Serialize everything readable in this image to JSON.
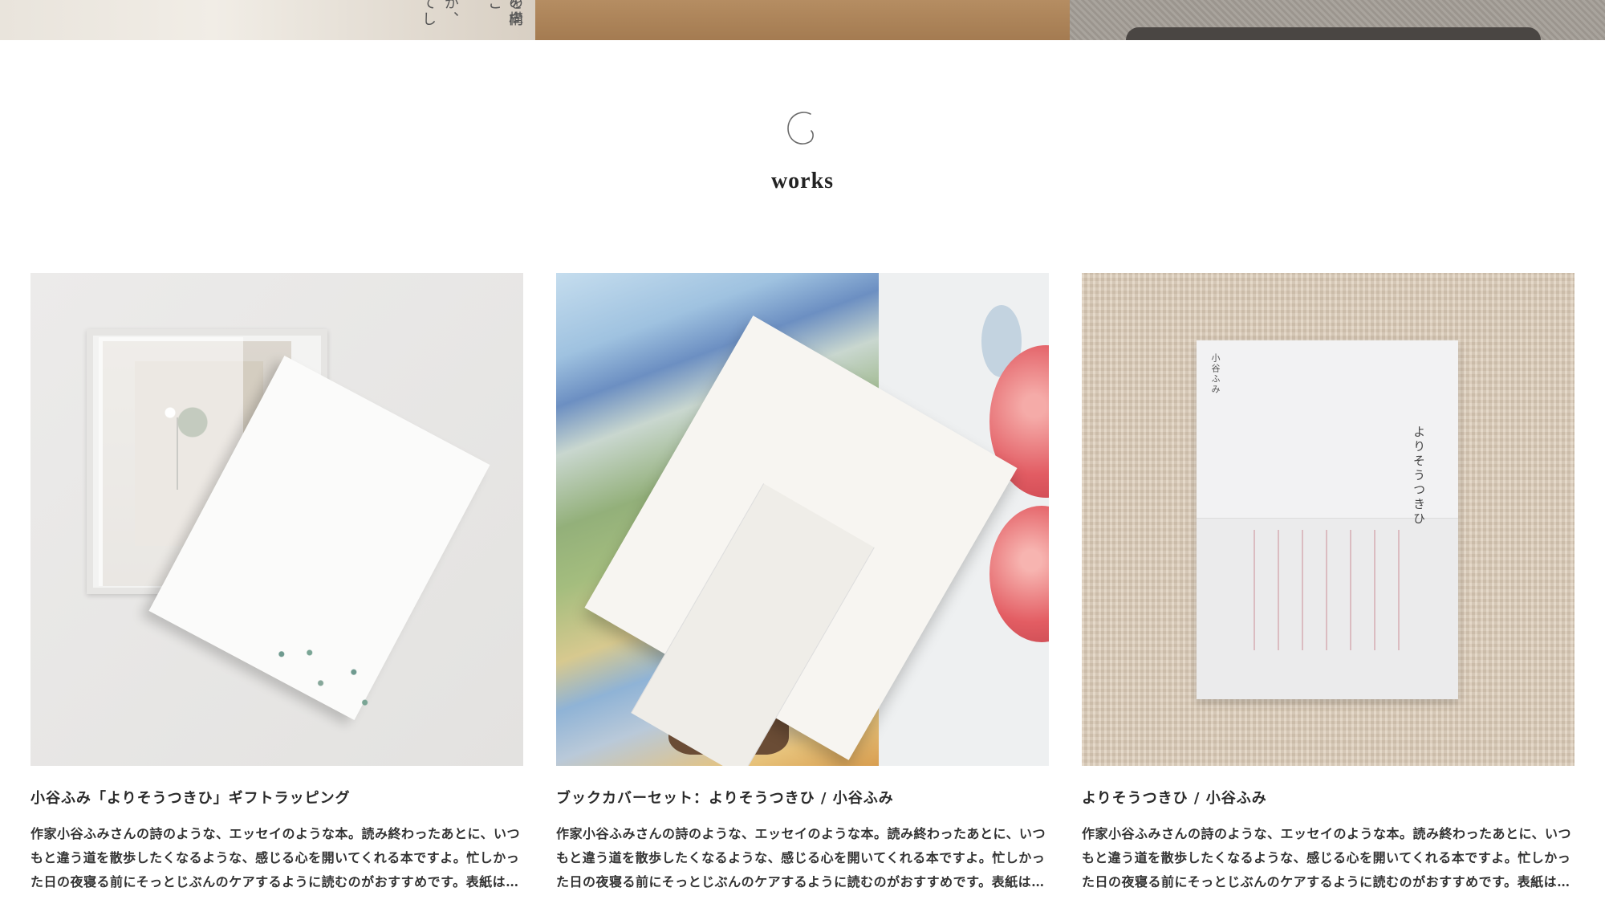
{
  "top_strip": {
    "vertical_text_1": "を構",
    "vertical_text_2": "の向こ",
    "vertical_text_3": "が、",
    "vertical_text_4": "てし"
  },
  "section": {
    "title": "works"
  },
  "works": [
    {
      "title": "小谷ふみ「よりそうつきひ」ギフトラッピング",
      "description": "作家小谷ふみさんの詩のような、エッセイのような本。読み終わったあとに、いつもと違う道を散歩したくなるような、感じる心を開いてくれる本ですよ。忙しかった日の夜寝る前にそっとじぶんのケアするように読むのがおすすめです。表紙は…"
    },
    {
      "title": "ブックカバーセット：よりそうつきひ / 小谷ふみ",
      "description": "作家小谷ふみさんの詩のような、エッセイのような本。読み終わったあとに、いつもと違う道を散歩したくなるような、感じる心を開いてくれる本ですよ。忙しかった日の夜寝る前にそっとじぶんのケアするように読むのがおすすめです。表紙は…"
    },
    {
      "title": "よりそうつきひ / 小谷ふみ",
      "description": "作家小谷ふみさんの詩のような、エッセイのような本。読み終わったあとに、いつもと違う道を散歩したくなるような、感じる心を開いてくれる本ですよ。忙しかった日の夜寝る前にそっとじぶんのケアするように読むのがおすすめです。表紙は…",
      "cover_author": "小谷ふみ",
      "cover_title": "よりそうつきひ"
    }
  ],
  "colors": {
    "text": "#222222",
    "background": "#ffffff"
  },
  "icons": {
    "section_logo": "crescent-logo-icon"
  }
}
